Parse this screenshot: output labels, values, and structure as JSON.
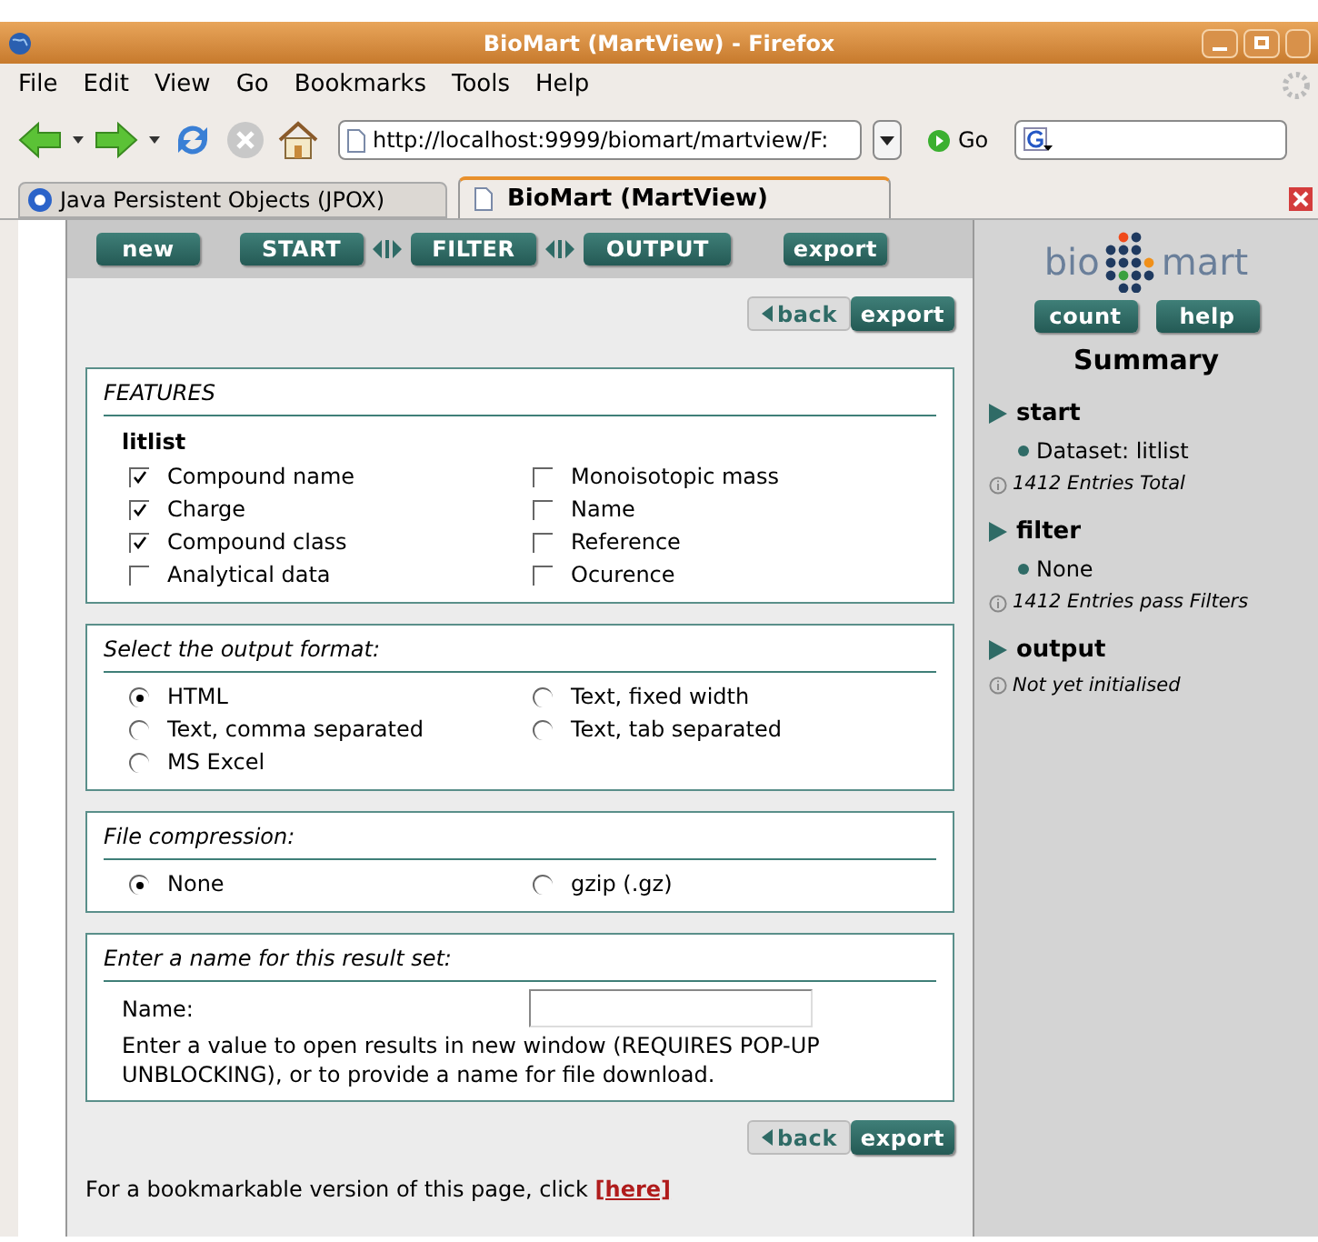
{
  "window": {
    "title": "BioMart (MartView) - Firefox"
  },
  "menu": [
    "File",
    "Edit",
    "View",
    "Go",
    "Bookmarks",
    "Tools",
    "Help"
  ],
  "address": {
    "value": "http://localhost:9999/biomart/martview/F:"
  },
  "go_label": "Go",
  "tabs": [
    {
      "label": "Java Persistent Objects (JPOX)",
      "selected": false
    },
    {
      "label": "BioMart (MartView)",
      "selected": true
    }
  ],
  "nav": {
    "new": "new",
    "steps": [
      "START",
      "FILTER",
      "OUTPUT"
    ],
    "export": "export"
  },
  "actions": {
    "back": "back",
    "export": "export"
  },
  "features": {
    "title": "FEATURES",
    "dataset": "litlist",
    "items": [
      {
        "label": "Compound name",
        "checked": true
      },
      {
        "label": "Monoisotopic mass",
        "checked": false
      },
      {
        "label": "Charge",
        "checked": true
      },
      {
        "label": "Name",
        "checked": false
      },
      {
        "label": "Compound class",
        "checked": true
      },
      {
        "label": "Reference",
        "checked": false
      },
      {
        "label": "Analytical data",
        "checked": false
      },
      {
        "label": "Ocurence",
        "checked": false
      }
    ]
  },
  "output_format": {
    "title": "Select the output format:",
    "options": [
      {
        "label": "HTML",
        "selected": true
      },
      {
        "label": "Text, fixed width",
        "selected": false
      },
      {
        "label": "Text, comma separated",
        "selected": false
      },
      {
        "label": "Text, tab separated",
        "selected": false
      },
      {
        "label": "MS Excel",
        "selected": false
      }
    ]
  },
  "compression": {
    "title": "File compression:",
    "options": [
      {
        "label": "None",
        "selected": true
      },
      {
        "label": "gzip (.gz)",
        "selected": false
      }
    ]
  },
  "result_name": {
    "title": "Enter a name for this result set:",
    "label": "Name:",
    "help": "Enter a value to open results in new window (REQUIRES POP-UP UNBLOCKING), or to provide a name for file download."
  },
  "actions_bottom": {
    "back": "back",
    "export": "export"
  },
  "footer": {
    "text": "For a bookmarkable version of this page, click ",
    "link": "[here]"
  },
  "sidebar": {
    "logo": {
      "left": "bio",
      "right": "mart"
    },
    "buttons": [
      "count",
      "help"
    ],
    "title": "Summary",
    "sections": [
      {
        "heading": "start",
        "items": [
          "Dataset: litlist"
        ],
        "info": "1412 Entries Total"
      },
      {
        "heading": "filter",
        "items": [
          "None"
        ],
        "info": "1412 Entries pass Filters"
      },
      {
        "heading": "output",
        "info": "Not yet initialised"
      }
    ]
  }
}
